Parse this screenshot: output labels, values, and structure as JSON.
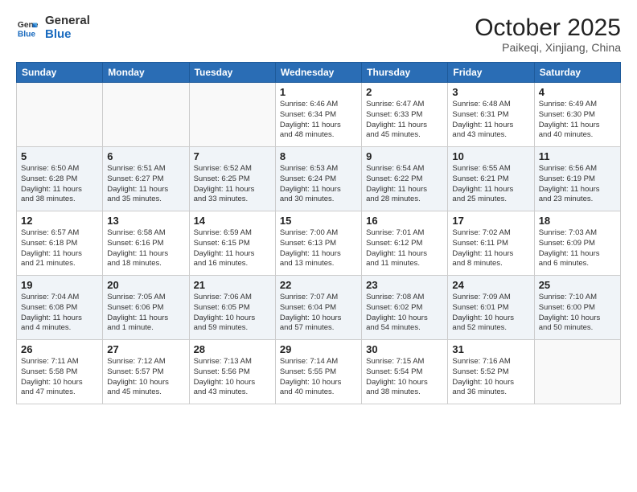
{
  "logo": {
    "line1": "General",
    "line2": "Blue"
  },
  "title": "October 2025",
  "subtitle": "Paikeqi, Xinjiang, China",
  "weekdays": [
    "Sunday",
    "Monday",
    "Tuesday",
    "Wednesday",
    "Thursday",
    "Friday",
    "Saturday"
  ],
  "weeks": [
    [
      {
        "day": "",
        "info": ""
      },
      {
        "day": "",
        "info": ""
      },
      {
        "day": "",
        "info": ""
      },
      {
        "day": "1",
        "info": "Sunrise: 6:46 AM\nSunset: 6:34 PM\nDaylight: 11 hours\nand 48 minutes."
      },
      {
        "day": "2",
        "info": "Sunrise: 6:47 AM\nSunset: 6:33 PM\nDaylight: 11 hours\nand 45 minutes."
      },
      {
        "day": "3",
        "info": "Sunrise: 6:48 AM\nSunset: 6:31 PM\nDaylight: 11 hours\nand 43 minutes."
      },
      {
        "day": "4",
        "info": "Sunrise: 6:49 AM\nSunset: 6:30 PM\nDaylight: 11 hours\nand 40 minutes."
      }
    ],
    [
      {
        "day": "5",
        "info": "Sunrise: 6:50 AM\nSunset: 6:28 PM\nDaylight: 11 hours\nand 38 minutes."
      },
      {
        "day": "6",
        "info": "Sunrise: 6:51 AM\nSunset: 6:27 PM\nDaylight: 11 hours\nand 35 minutes."
      },
      {
        "day": "7",
        "info": "Sunrise: 6:52 AM\nSunset: 6:25 PM\nDaylight: 11 hours\nand 33 minutes."
      },
      {
        "day": "8",
        "info": "Sunrise: 6:53 AM\nSunset: 6:24 PM\nDaylight: 11 hours\nand 30 minutes."
      },
      {
        "day": "9",
        "info": "Sunrise: 6:54 AM\nSunset: 6:22 PM\nDaylight: 11 hours\nand 28 minutes."
      },
      {
        "day": "10",
        "info": "Sunrise: 6:55 AM\nSunset: 6:21 PM\nDaylight: 11 hours\nand 25 minutes."
      },
      {
        "day": "11",
        "info": "Sunrise: 6:56 AM\nSunset: 6:19 PM\nDaylight: 11 hours\nand 23 minutes."
      }
    ],
    [
      {
        "day": "12",
        "info": "Sunrise: 6:57 AM\nSunset: 6:18 PM\nDaylight: 11 hours\nand 21 minutes."
      },
      {
        "day": "13",
        "info": "Sunrise: 6:58 AM\nSunset: 6:16 PM\nDaylight: 11 hours\nand 18 minutes."
      },
      {
        "day": "14",
        "info": "Sunrise: 6:59 AM\nSunset: 6:15 PM\nDaylight: 11 hours\nand 16 minutes."
      },
      {
        "day": "15",
        "info": "Sunrise: 7:00 AM\nSunset: 6:13 PM\nDaylight: 11 hours\nand 13 minutes."
      },
      {
        "day": "16",
        "info": "Sunrise: 7:01 AM\nSunset: 6:12 PM\nDaylight: 11 hours\nand 11 minutes."
      },
      {
        "day": "17",
        "info": "Sunrise: 7:02 AM\nSunset: 6:11 PM\nDaylight: 11 hours\nand 8 minutes."
      },
      {
        "day": "18",
        "info": "Sunrise: 7:03 AM\nSunset: 6:09 PM\nDaylight: 11 hours\nand 6 minutes."
      }
    ],
    [
      {
        "day": "19",
        "info": "Sunrise: 7:04 AM\nSunset: 6:08 PM\nDaylight: 11 hours\nand 4 minutes."
      },
      {
        "day": "20",
        "info": "Sunrise: 7:05 AM\nSunset: 6:06 PM\nDaylight: 11 hours\nand 1 minute."
      },
      {
        "day": "21",
        "info": "Sunrise: 7:06 AM\nSunset: 6:05 PM\nDaylight: 10 hours\nand 59 minutes."
      },
      {
        "day": "22",
        "info": "Sunrise: 7:07 AM\nSunset: 6:04 PM\nDaylight: 10 hours\nand 57 minutes."
      },
      {
        "day": "23",
        "info": "Sunrise: 7:08 AM\nSunset: 6:02 PM\nDaylight: 10 hours\nand 54 minutes."
      },
      {
        "day": "24",
        "info": "Sunrise: 7:09 AM\nSunset: 6:01 PM\nDaylight: 10 hours\nand 52 minutes."
      },
      {
        "day": "25",
        "info": "Sunrise: 7:10 AM\nSunset: 6:00 PM\nDaylight: 10 hours\nand 50 minutes."
      }
    ],
    [
      {
        "day": "26",
        "info": "Sunrise: 7:11 AM\nSunset: 5:58 PM\nDaylight: 10 hours\nand 47 minutes."
      },
      {
        "day": "27",
        "info": "Sunrise: 7:12 AM\nSunset: 5:57 PM\nDaylight: 10 hours\nand 45 minutes."
      },
      {
        "day": "28",
        "info": "Sunrise: 7:13 AM\nSunset: 5:56 PM\nDaylight: 10 hours\nand 43 minutes."
      },
      {
        "day": "29",
        "info": "Sunrise: 7:14 AM\nSunset: 5:55 PM\nDaylight: 10 hours\nand 40 minutes."
      },
      {
        "day": "30",
        "info": "Sunrise: 7:15 AM\nSunset: 5:54 PM\nDaylight: 10 hours\nand 38 minutes."
      },
      {
        "day": "31",
        "info": "Sunrise: 7:16 AM\nSunset: 5:52 PM\nDaylight: 10 hours\nand 36 minutes."
      },
      {
        "day": "",
        "info": ""
      }
    ]
  ]
}
